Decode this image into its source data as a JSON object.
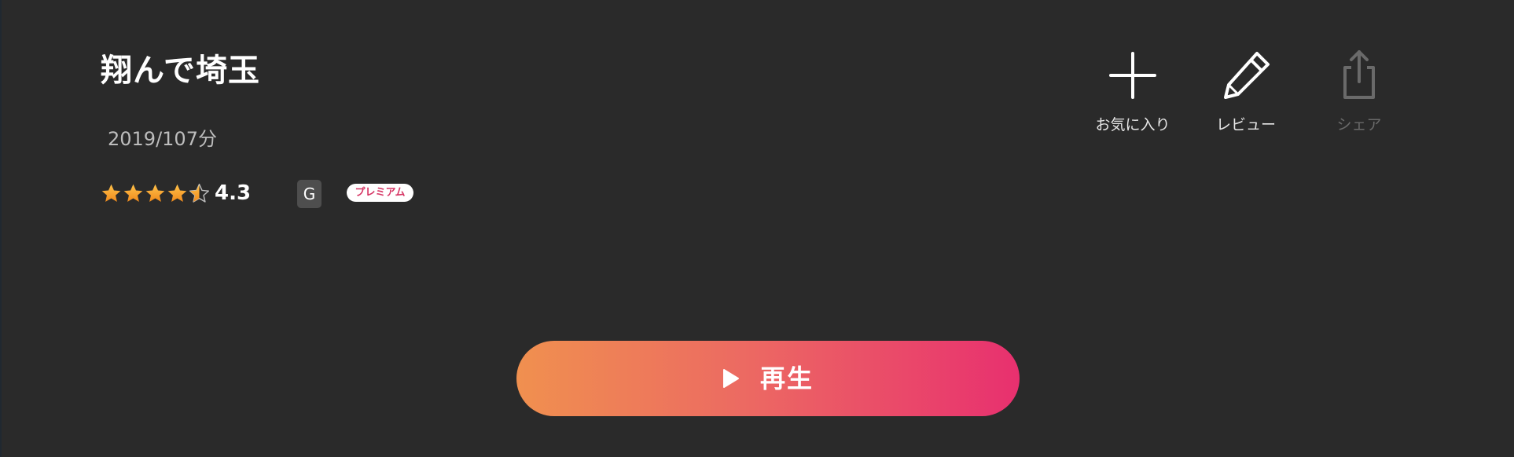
{
  "title": "翔んで埼玉",
  "meta": "2019/107分",
  "rating": {
    "value": "4.3",
    "stars": 4.5,
    "star_color": "#f6a623"
  },
  "badges": {
    "age": "G",
    "premium": "プレミアム"
  },
  "actions": [
    {
      "label": "お気に入り",
      "icon": "plus-icon",
      "enabled": true
    },
    {
      "label": "レビュー",
      "icon": "pencil-icon",
      "enabled": true
    },
    {
      "label": "シェア",
      "icon": "share-icon",
      "enabled": false
    }
  ],
  "play": {
    "label": "再生",
    "icon": "play-icon",
    "gradient": [
      "#f0904f",
      "#e8306f"
    ]
  },
  "colors": {
    "background": "#2a2a2a",
    "accent": "#e8306f"
  }
}
